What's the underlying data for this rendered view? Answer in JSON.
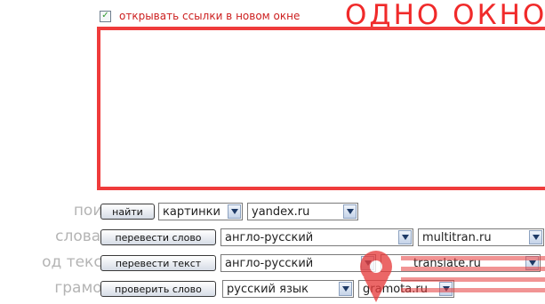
{
  "new_window_option": {
    "label": "открывать ссылки в новом окне",
    "checked": true
  },
  "title": "ОДНО ОКНО",
  "rows": [
    {
      "label": "поиск",
      "button": "найти",
      "selects": [
        "картинки",
        "yandex.ru"
      ]
    },
    {
      "label": "словари",
      "button": "перевести слово",
      "selects": [
        "англо-русский",
        "multitran.ru"
      ]
    },
    {
      "label": "од текста",
      "button": "перевести текст",
      "selects": [
        "англо-русский",
        "translate.ru"
      ]
    },
    {
      "label": "грамота",
      "button": "проверить слово",
      "selects": [
        "русский язык",
        "gramota.ru"
      ]
    }
  ],
  "colors": {
    "accent_red": "#ef3b3b",
    "label_grey": "#b4b4b4",
    "watermark_red": "#e63d3d"
  },
  "watermark": {
    "icon": "pin-icon"
  }
}
